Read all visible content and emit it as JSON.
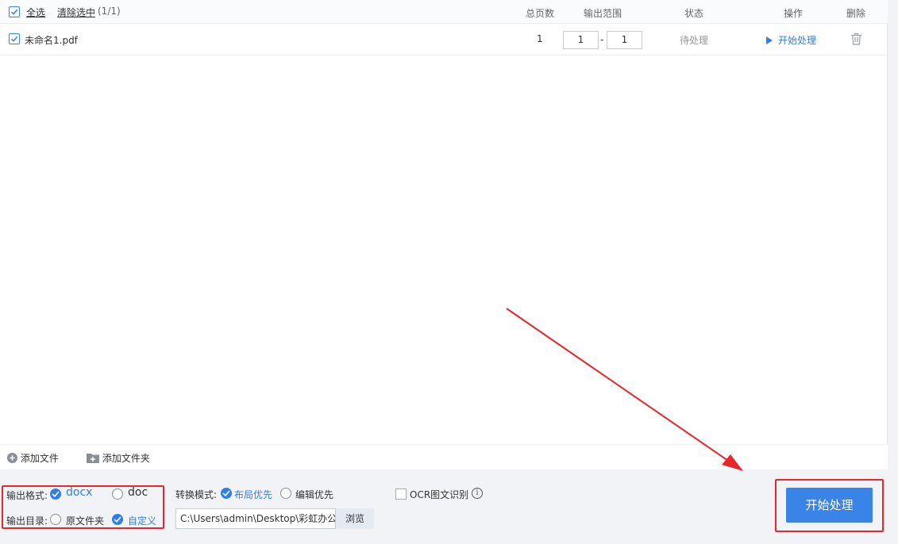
{
  "header": {
    "select_all": "全选",
    "clear_selected": "清除选中",
    "selected_count": "(1/1)",
    "col_total_pages": "总页数",
    "col_output_range": "输出范围",
    "col_status": "状态",
    "col_action": "操作",
    "col_delete": "删除"
  },
  "files": [
    {
      "name": "未命名1.pdf",
      "total_pages": "1",
      "range_from": "1",
      "range_sep": "-",
      "range_to": "1",
      "status": "待处理",
      "action": "开始处理"
    }
  ],
  "add_bar": {
    "add_file": "添加文件",
    "add_folder": "添加文件夹"
  },
  "options": {
    "format_label": "输出格式:",
    "format_docx": "docx",
    "format_doc": "doc",
    "format_selected": "docx",
    "dir_label": "输出目录:",
    "dir_original": "原文件夹",
    "dir_custom": "自定义",
    "dir_selected": "自定义",
    "mode_label": "转换模式:",
    "mode_layout": "布局优先",
    "mode_edit": "编辑优先",
    "mode_selected": "布局优先",
    "path_value": "C:\\Users\\admin\\Desktop\\彩虹办公",
    "browse": "浏览",
    "ocr_label": "OCR图文识别",
    "ocr_checked": false,
    "info_glyph": "i"
  },
  "start_button": "开始处理",
  "colors": {
    "accent": "#3a84e8",
    "annotation_red": "#e8262b"
  },
  "icons": [
    "checkbox-checked-icon",
    "trash-icon",
    "plus-circle-icon",
    "folder-plus-icon",
    "play-icon",
    "info-icon"
  ]
}
